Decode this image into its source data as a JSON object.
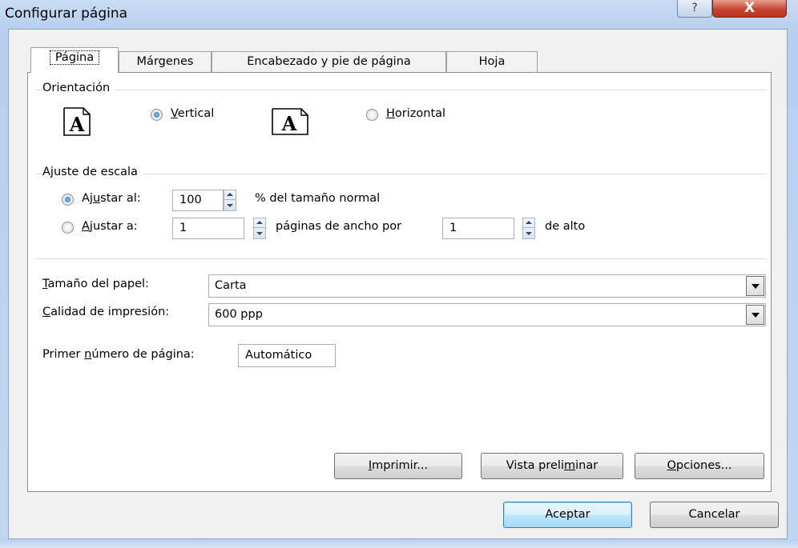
{
  "window": {
    "title": "Configurar página",
    "help_symbol": "?",
    "close_symbol": "X"
  },
  "tabs": [
    {
      "label": "Página",
      "active": true
    },
    {
      "label": "Márgenes",
      "active": false
    },
    {
      "label": "Encabezado y pie de página",
      "active": false
    },
    {
      "label": "Hoja",
      "active": false
    }
  ],
  "orientation": {
    "group_label": "Orientación",
    "vertical_label": "Vertical",
    "vertical_checked": true,
    "horizontal_label": "Horizontal",
    "horizontal_checked": false,
    "icon_letter": "A"
  },
  "scaling": {
    "group_label": "Ajuste de escala",
    "adjust_to_label": "Ajustar al:",
    "adjust_to_checked": true,
    "adjust_to_value": "100",
    "adjust_to_suffix": "% del tamaño normal",
    "fit_to_label": "Ajustar a:",
    "fit_to_checked": false,
    "fit_wide_value": "1",
    "fit_wide_suffix": "páginas de ancho por",
    "fit_tall_value": "1",
    "fit_tall_suffix": "de alto"
  },
  "paper": {
    "size_label": "Tamaño del papel:",
    "size_value": "Carta",
    "quality_label": "Calidad de impresión:",
    "quality_value": "600 ppp",
    "first_page_label": "Primer número de página:",
    "first_page_value": "Automático"
  },
  "panel_buttons": {
    "print": "Imprimir...",
    "preview": "Vista preliminar",
    "options": "Opciones..."
  },
  "dialog_buttons": {
    "ok": "Aceptar",
    "cancel": "Cancelar"
  },
  "colors": {
    "title_bar": "#b7cfee",
    "close_button": "#c64631",
    "radio_checked": "#1d5fb8"
  }
}
